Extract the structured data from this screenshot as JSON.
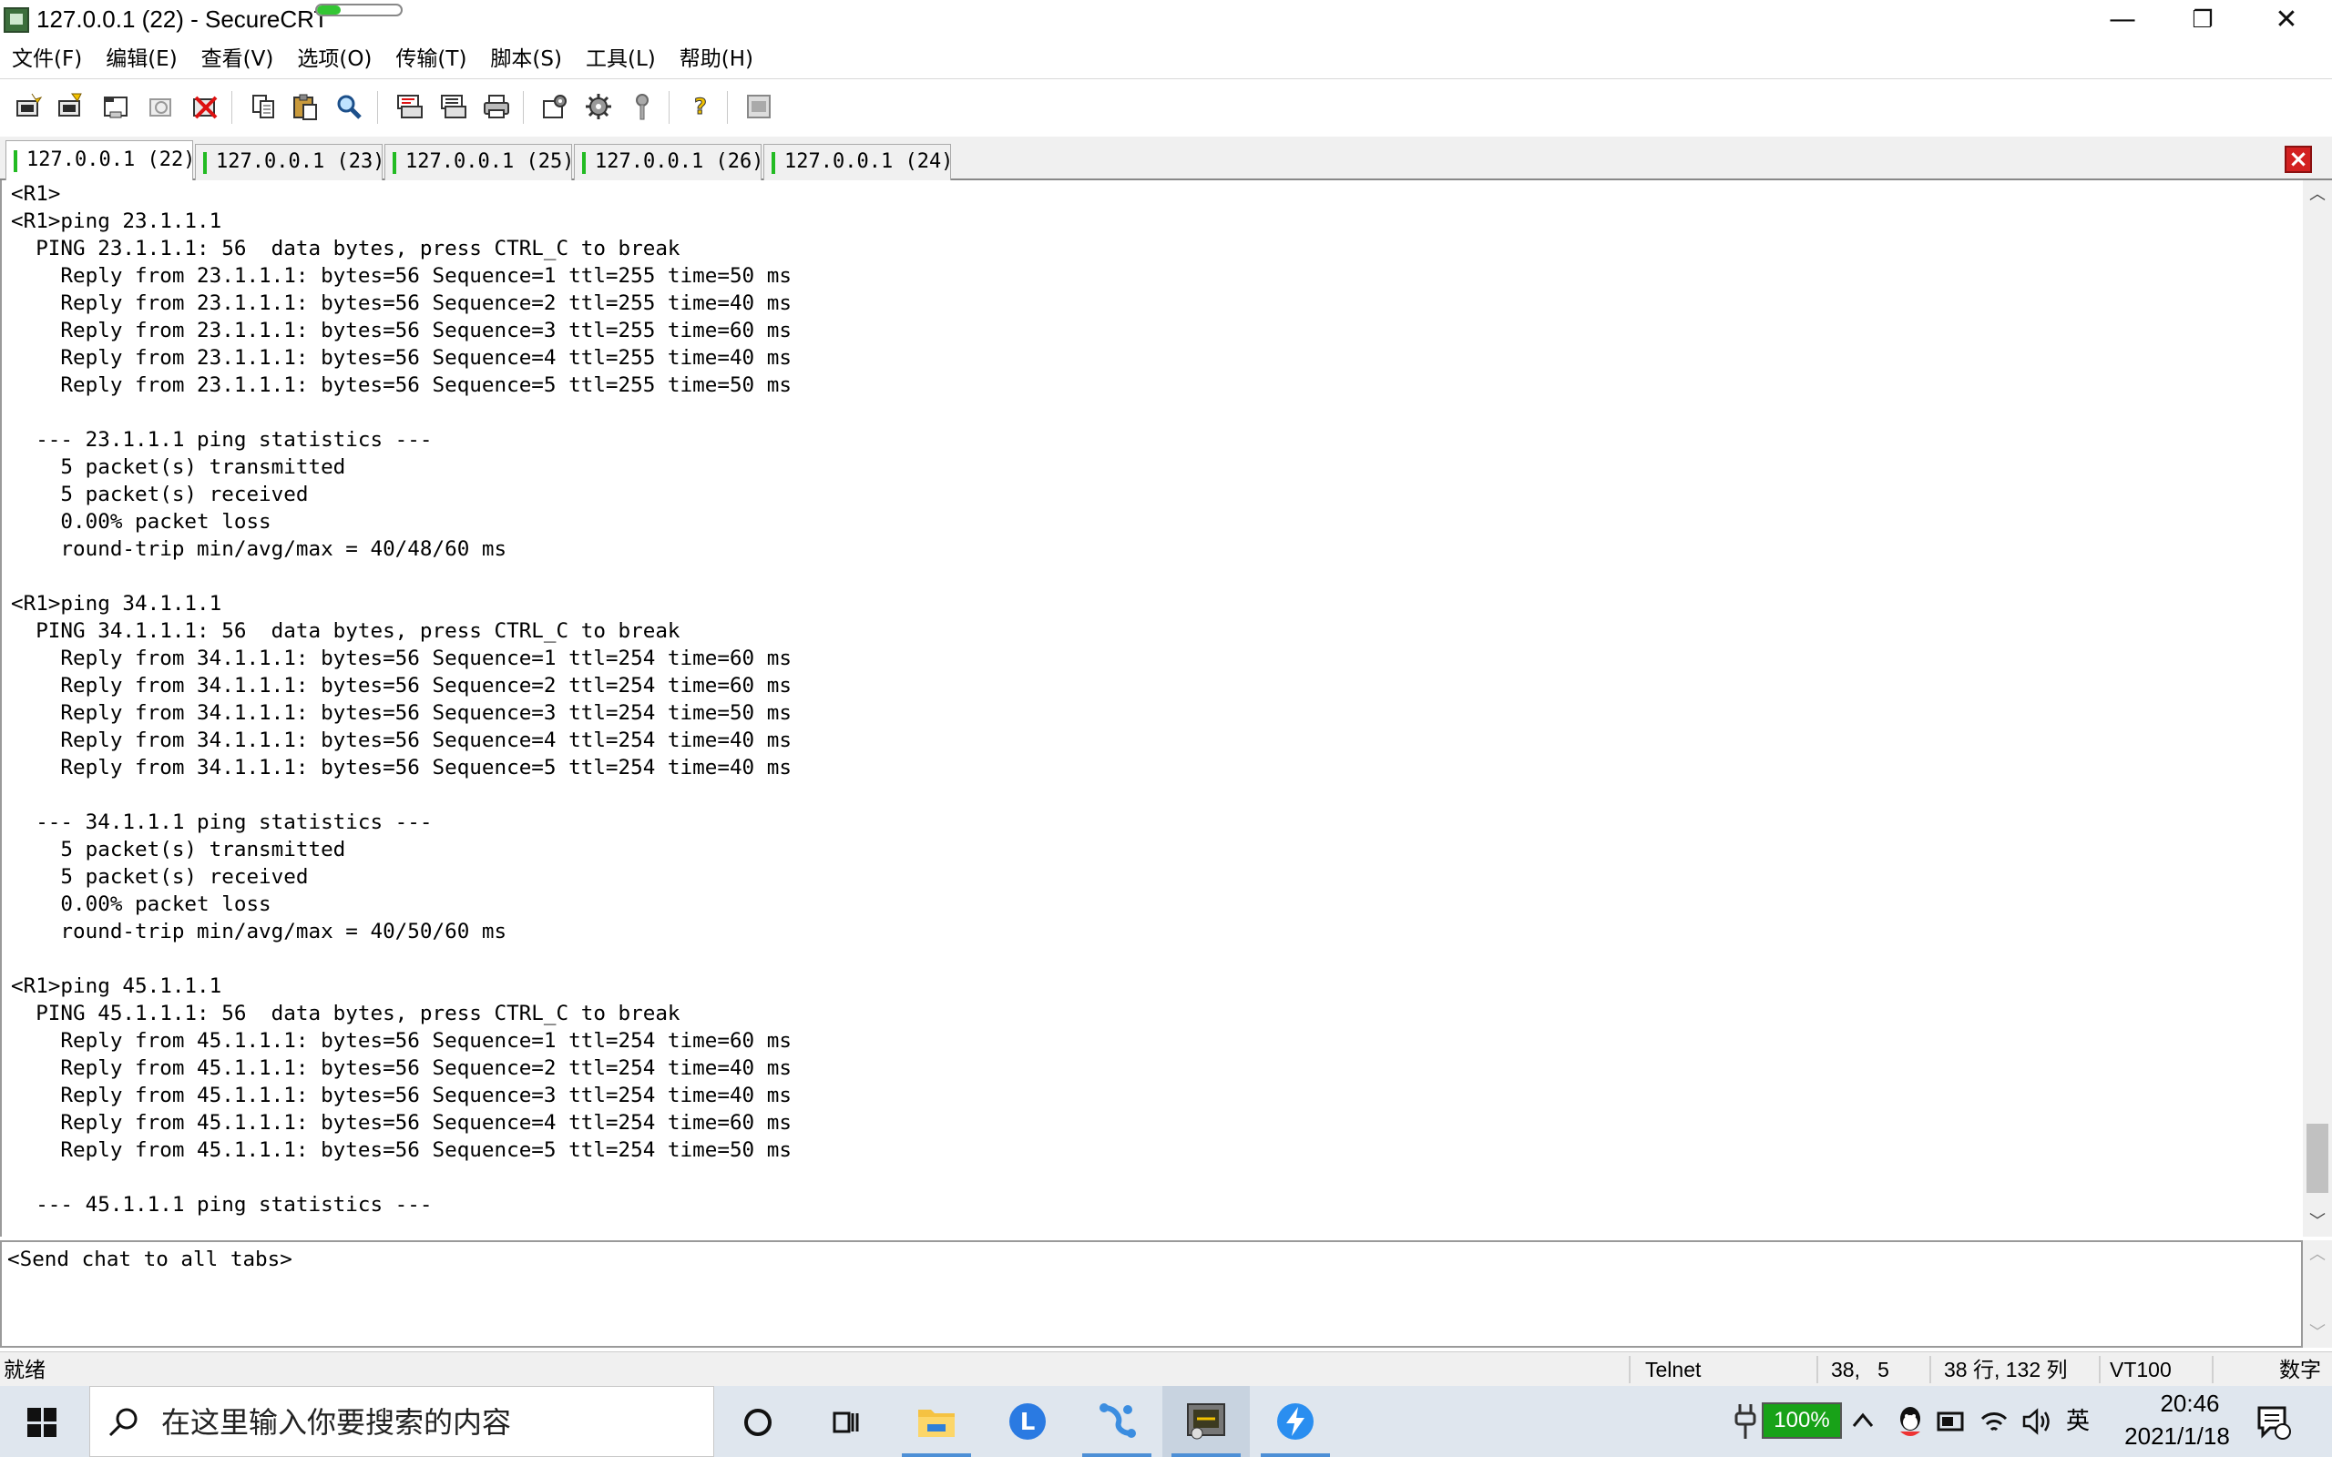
{
  "window": {
    "title": "127.0.0.1 (22) - SecureCRT",
    "progress_fraction": 0.28,
    "controls": {
      "minimize": "—",
      "maximize": "❐",
      "close": "✕"
    }
  },
  "menu": [
    "文件(F)",
    "编辑(E)",
    "查看(V)",
    "选项(O)",
    "传输(T)",
    "脚本(S)",
    "工具(L)",
    "帮助(H)"
  ],
  "toolbar": {
    "buttons": [
      "connect-icon",
      "quick-connect-icon",
      "connect-in-tab-icon",
      "reconnect-icon",
      "disconnect-icon",
      "copy-icon",
      "paste-icon",
      "find-icon",
      "print-setup-icon",
      "print-selection-icon",
      "print-icon",
      "session-options-icon",
      "global-options-icon",
      "keymap-icon",
      "help-icon",
      "sftp-icon"
    ]
  },
  "tabs": [
    {
      "label": "127.0.0.1 (22)",
      "active": true
    },
    {
      "label": "127.0.0.1 (23)",
      "active": false
    },
    {
      "label": "127.0.0.1 (25)",
      "active": false
    },
    {
      "label": "127.0.0.1 (26)",
      "active": false
    },
    {
      "label": "127.0.0.1 (24)",
      "active": false
    }
  ],
  "tab_close": "×",
  "scrollbar": {
    "up": "︿",
    "down": "﹀",
    "chat_up": "︿",
    "chat_down": "﹀"
  },
  "terminal": {
    "lines": [
      "<R1>",
      "<R1>ping 23.1.1.1",
      "  PING 23.1.1.1: 56  data bytes, press CTRL_C to break",
      "    Reply from 23.1.1.1: bytes=56 Sequence=1 ttl=255 time=50 ms",
      "    Reply from 23.1.1.1: bytes=56 Sequence=2 ttl=255 time=40 ms",
      "    Reply from 23.1.1.1: bytes=56 Sequence=3 ttl=255 time=60 ms",
      "    Reply from 23.1.1.1: bytes=56 Sequence=4 ttl=255 time=40 ms",
      "    Reply from 23.1.1.1: bytes=56 Sequence=5 ttl=255 time=50 ms",
      "",
      "  --- 23.1.1.1 ping statistics ---",
      "    5 packet(s) transmitted",
      "    5 packet(s) received",
      "    0.00% packet loss",
      "    round-trip min/avg/max = 40/48/60 ms",
      "",
      "<R1>ping 34.1.1.1",
      "  PING 34.1.1.1: 56  data bytes, press CTRL_C to break",
      "    Reply from 34.1.1.1: bytes=56 Sequence=1 ttl=254 time=60 ms",
      "    Reply from 34.1.1.1: bytes=56 Sequence=2 ttl=254 time=60 ms",
      "    Reply from 34.1.1.1: bytes=56 Sequence=3 ttl=254 time=50 ms",
      "    Reply from 34.1.1.1: bytes=56 Sequence=4 ttl=254 time=40 ms",
      "    Reply from 34.1.1.1: bytes=56 Sequence=5 ttl=254 time=40 ms",
      "",
      "  --- 34.1.1.1 ping statistics ---",
      "    5 packet(s) transmitted",
      "    5 packet(s) received",
      "    0.00% packet loss",
      "    round-trip min/avg/max = 40/50/60 ms",
      "",
      "<R1>ping 45.1.1.1",
      "  PING 45.1.1.1: 56  data bytes, press CTRL_C to break",
      "    Reply from 45.1.1.1: bytes=56 Sequence=1 ttl=254 time=60 ms",
      "    Reply from 45.1.1.1: bytes=56 Sequence=2 ttl=254 time=40 ms",
      "    Reply from 45.1.1.1: bytes=56 Sequence=3 ttl=254 time=40 ms",
      "    Reply from 45.1.1.1: bytes=56 Sequence=4 ttl=254 time=60 ms",
      "    Reply from 45.1.1.1: bytes=56 Sequence=5 ttl=254 time=50 ms",
      "",
      "  --- 45.1.1.1 ping statistics ---"
    ]
  },
  "chat": {
    "placeholder": "<Send chat to all tabs>"
  },
  "status": {
    "ready": "就绪",
    "protocol": "Telnet",
    "cursor": "38,   5",
    "size": "38 行, 132 列",
    "emulation": "VT100",
    "numlock": "数字"
  },
  "taskbar": {
    "search_placeholder": "在这里输入你要搜索的内容",
    "battery": "100%",
    "ime": "英",
    "time": "20:46",
    "date": "2021/1/18",
    "apps": [
      "cortana-icon",
      "task-view-icon",
      "file-explorer-icon",
      "l-app-icon",
      "git-icon",
      "securecrt-icon",
      "lightning-icon"
    ]
  },
  "colors": {
    "tab_connected": "#22bb22",
    "tab_close": "#d32020",
    "battery": "#18a218",
    "taskbar": "#dfe6ee"
  }
}
